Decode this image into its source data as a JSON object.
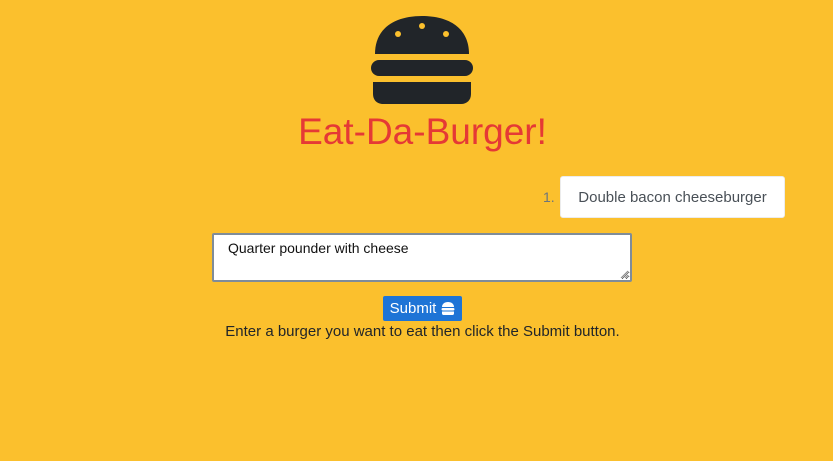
{
  "app": {
    "title": "Eat-Da-Burger!",
    "logo_icon": "hamburger-icon"
  },
  "burgers": [
    {
      "number": "1.",
      "name": "Double bacon cheeseburger"
    }
  ],
  "form": {
    "input_value": "Quarter pounder with cheese",
    "submit_label": "Submit",
    "submit_icon": "hamburger-icon",
    "instructions": "Enter a burger you want to eat then click the Submit button."
  },
  "colors": {
    "background": "#fbc02d",
    "title": "#e53935",
    "button": "#1e74d6",
    "logo": "#212529"
  }
}
